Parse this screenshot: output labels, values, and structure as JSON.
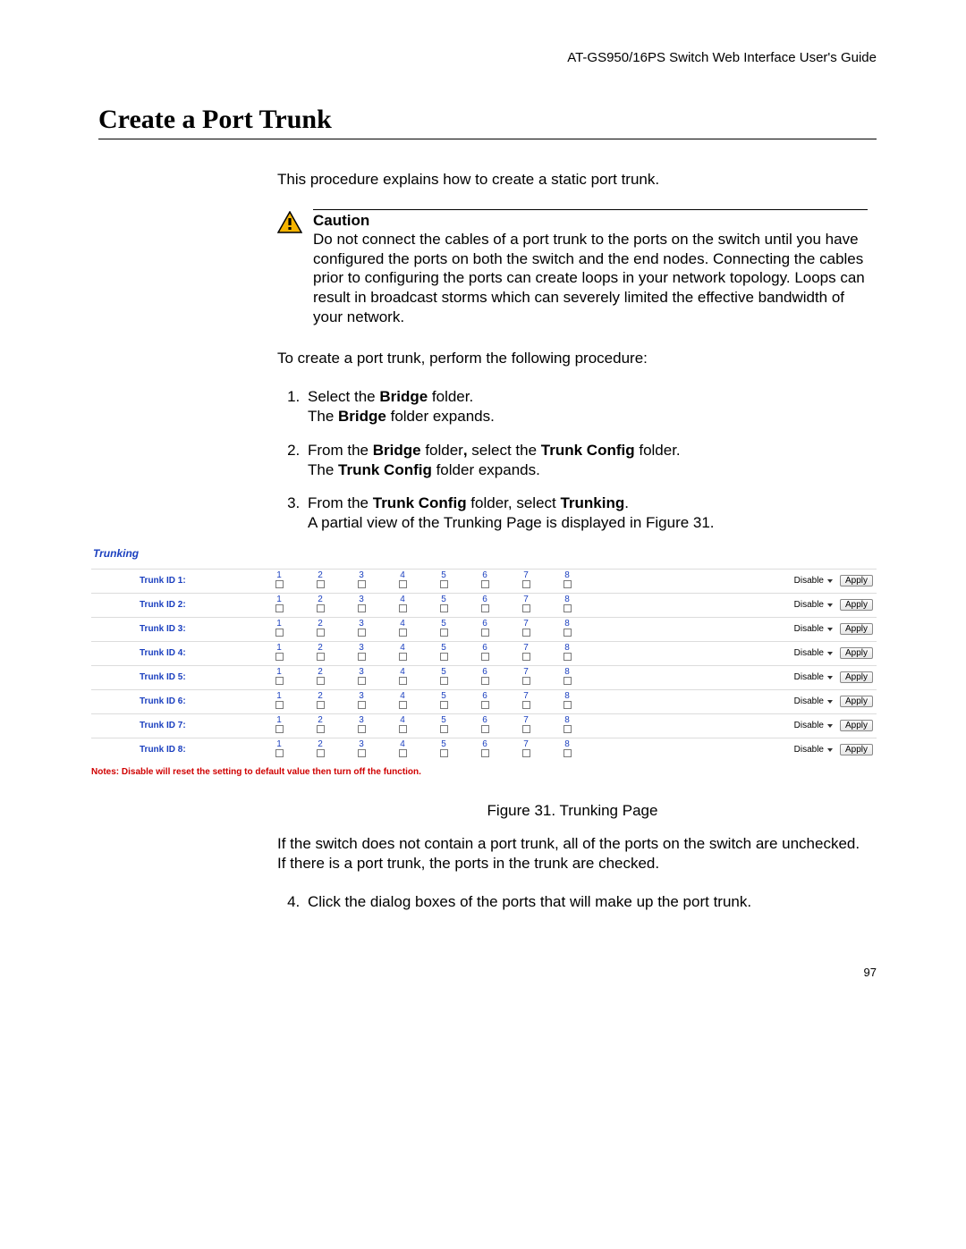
{
  "header": {
    "running": "AT-GS950/16PS Switch Web Interface User's Guide"
  },
  "title": "Create a Port Trunk",
  "intro": "This procedure explains how to create a static port trunk.",
  "caution": {
    "label": "Caution",
    "text": "Do not connect the cables of a port trunk to the ports on the switch until you have configured the ports on both the switch and the end nodes. Connecting the cables prior to configuring the ports can create loops in your network topology. Loops can result in broadcast storms which can severely limited the effective bandwidth of your network."
  },
  "lead": "To create a port trunk, perform the following procedure:",
  "steps": {
    "s1a": "Select the ",
    "s1b": "Bridge",
    "s1c": " folder.",
    "s1d": "The ",
    "s1e": "Bridge",
    "s1f": " folder expands.",
    "s2a": "From the ",
    "s2b": "Bridge",
    "s2c": " folder",
    "s2comma": ", ",
    "s2d": "select the ",
    "s2e": "Trunk Config",
    "s2f": " folder.",
    "s2g": "The ",
    "s2h": "Trunk Config",
    "s2i": " folder expands.",
    "s3a": "From the ",
    "s3b": "Trunk Config",
    "s3c": " folder, select ",
    "s3d": "Trunking",
    "s3e": ".",
    "s3f": "A partial view of the Trunking Page is displayed in Figure 31.",
    "s4": "Click the dialog boxes of the ports that will make up the port trunk."
  },
  "figure": {
    "title": "Trunking",
    "ports": [
      "1",
      "2",
      "3",
      "4",
      "5",
      "6",
      "7",
      "8"
    ],
    "rows": [
      {
        "id": "Trunk ID 1:"
      },
      {
        "id": "Trunk ID 2:"
      },
      {
        "id": "Trunk ID 3:"
      },
      {
        "id": "Trunk ID 4:"
      },
      {
        "id": "Trunk ID 5:"
      },
      {
        "id": "Trunk ID 6:"
      },
      {
        "id": "Trunk ID 7:"
      },
      {
        "id": "Trunk ID 8:"
      }
    ],
    "dropdown": "Disable",
    "button": "Apply",
    "notes": "Notes: Disable will reset the setting to default value then turn off the function.",
    "caption": "Figure 31. Trunking Page"
  },
  "after_figure": "If the switch does not contain a port trunk, all of the ports on the switch are unchecked. If there is a port trunk, the ports in the trunk are checked.",
  "page_number": "97"
}
